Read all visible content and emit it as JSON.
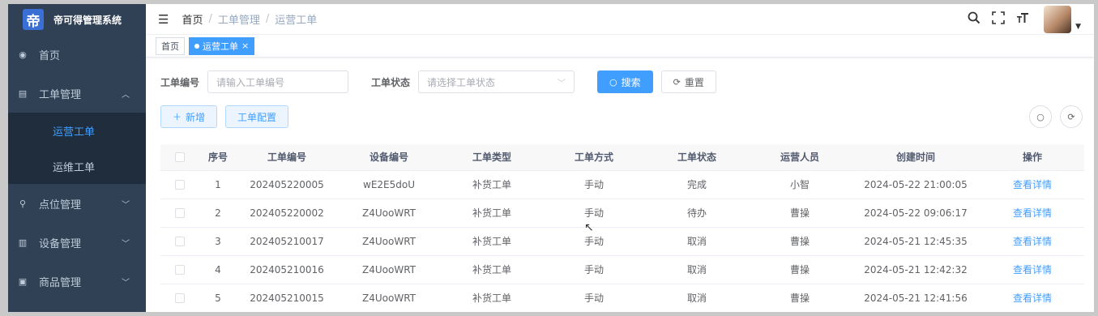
{
  "app": {
    "title": "帝可得管理系统",
    "logo_char": "帝"
  },
  "sidebar": {
    "items": [
      {
        "label": "首页",
        "icon": "dashboard-icon"
      },
      {
        "label": "工单管理",
        "icon": "clipboard-icon",
        "expanded": true,
        "children": [
          {
            "label": "运营工单",
            "active": true
          },
          {
            "label": "运维工单"
          }
        ]
      },
      {
        "label": "点位管理",
        "icon": "location-icon"
      },
      {
        "label": "设备管理",
        "icon": "device-icon"
      },
      {
        "label": "商品管理",
        "icon": "product-icon"
      }
    ]
  },
  "breadcrumb": [
    "首页",
    "工单管理",
    "运营工单"
  ],
  "tags": [
    {
      "label": "首页",
      "active": false
    },
    {
      "label": "运营工单",
      "active": true
    }
  ],
  "search": {
    "order_no_label": "工单编号",
    "order_no_placeholder": "请输入工单编号",
    "status_label": "工单状态",
    "status_placeholder": "请选择工单状态",
    "search_label": "搜索",
    "reset_label": "重置"
  },
  "toolbar": {
    "add_label": "新增",
    "config_label": "工单配置"
  },
  "table": {
    "headers": [
      "序号",
      "工单编号",
      "设备编号",
      "工单类型",
      "工单方式",
      "工单状态",
      "运营人员",
      "创建时间",
      "操作"
    ],
    "action_label": "查看详情",
    "rows": [
      [
        "1",
        "202405220005",
        "wE2E5doU",
        "补货工单",
        "手动",
        "完成",
        "小智",
        "2024-05-22 21:00:05"
      ],
      [
        "2",
        "202405220002",
        "Z4UooWRT",
        "补货工单",
        "手动",
        "待办",
        "曹操",
        "2024-05-22 09:06:17"
      ],
      [
        "3",
        "202405210017",
        "Z4UooWRT",
        "补货工单",
        "手动",
        "取消",
        "曹操",
        "2024-05-21 12:45:35"
      ],
      [
        "4",
        "202405210016",
        "Z4UooWRT",
        "补货工单",
        "手动",
        "取消",
        "曹操",
        "2024-05-21 12:42:32"
      ],
      [
        "5",
        "202405210015",
        "Z4UooWRT",
        "补货工单",
        "手动",
        "取消",
        "曹操",
        "2024-05-21 12:41:56"
      ]
    ]
  },
  "colors": {
    "sidebar_bg": "#304156",
    "primary": "#409eff"
  }
}
